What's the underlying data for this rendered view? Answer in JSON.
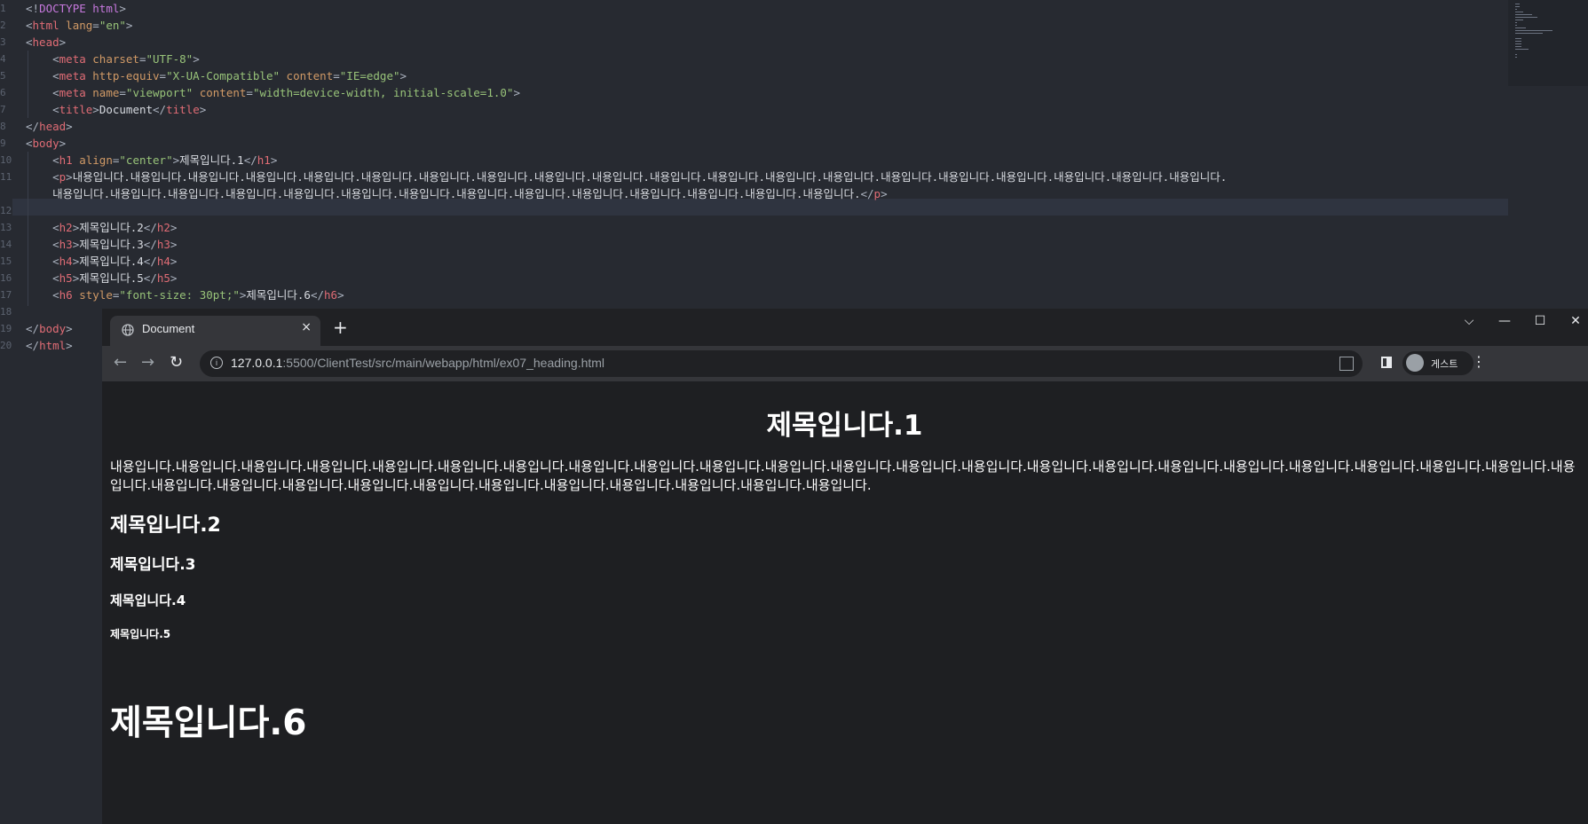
{
  "editor": {
    "lines": [
      {
        "n": "1",
        "parts": [
          [
            "punct",
            "<!"
          ],
          [
            "doct",
            "DOCTYPE"
          ],
          [
            "punct",
            " "
          ],
          [
            "doct",
            "html"
          ],
          [
            "punct",
            ">"
          ]
        ]
      },
      {
        "n": "2",
        "parts": [
          [
            "punct",
            "<"
          ],
          [
            "tag",
            "html"
          ],
          [
            "punct",
            " "
          ],
          [
            "attr",
            "lang"
          ],
          [
            "punct",
            "="
          ],
          [
            "str",
            "\"en\""
          ],
          [
            "punct",
            ">"
          ]
        ]
      },
      {
        "n": "3",
        "parts": [
          [
            "punct",
            "<"
          ],
          [
            "tag",
            "head"
          ],
          [
            "punct",
            ">"
          ]
        ]
      },
      {
        "n": "4",
        "parts": [
          [
            "punct",
            "    <"
          ],
          [
            "tag",
            "meta"
          ],
          [
            "punct",
            " "
          ],
          [
            "attr",
            "charset"
          ],
          [
            "punct",
            "="
          ],
          [
            "str",
            "\"UTF-8\""
          ],
          [
            "punct",
            ">"
          ]
        ]
      },
      {
        "n": "5",
        "parts": [
          [
            "punct",
            "    <"
          ],
          [
            "tag",
            "meta"
          ],
          [
            "punct",
            " "
          ],
          [
            "attr",
            "http-equiv"
          ],
          [
            "punct",
            "="
          ],
          [
            "str",
            "\"X-UA-Compatible\""
          ],
          [
            "punct",
            " "
          ],
          [
            "attr",
            "content"
          ],
          [
            "punct",
            "="
          ],
          [
            "str",
            "\"IE=edge\""
          ],
          [
            "punct",
            ">"
          ]
        ]
      },
      {
        "n": "6",
        "parts": [
          [
            "punct",
            "    <"
          ],
          [
            "tag",
            "meta"
          ],
          [
            "punct",
            " "
          ],
          [
            "attr",
            "name"
          ],
          [
            "punct",
            "="
          ],
          [
            "str",
            "\"viewport\""
          ],
          [
            "punct",
            " "
          ],
          [
            "attr",
            "content"
          ],
          [
            "punct",
            "="
          ],
          [
            "str",
            "\"width=device-width, initial-scale=1.0\""
          ],
          [
            "punct",
            ">"
          ]
        ]
      },
      {
        "n": "7",
        "parts": [
          [
            "punct",
            "    <"
          ],
          [
            "tag",
            "title"
          ],
          [
            "punct",
            ">"
          ],
          [
            "text",
            "Document"
          ],
          [
            "punct",
            "</"
          ],
          [
            "tag",
            "title"
          ],
          [
            "punct",
            ">"
          ]
        ]
      },
      {
        "n": "8",
        "parts": [
          [
            "punct",
            "</"
          ],
          [
            "tag",
            "head"
          ],
          [
            "punct",
            ">"
          ]
        ]
      },
      {
        "n": "9",
        "parts": [
          [
            "punct",
            "<"
          ],
          [
            "tag",
            "body"
          ],
          [
            "punct",
            ">"
          ]
        ]
      },
      {
        "n": "10",
        "parts": [
          [
            "punct",
            "    <"
          ],
          [
            "tag",
            "h1"
          ],
          [
            "punct",
            " "
          ],
          [
            "attr",
            "align"
          ],
          [
            "punct",
            "="
          ],
          [
            "str",
            "\"center\""
          ],
          [
            "punct",
            ">"
          ],
          [
            "text",
            "제목입니다.1"
          ],
          [
            "punct",
            "</"
          ],
          [
            "tag",
            "h1"
          ],
          [
            "punct",
            ">"
          ]
        ]
      },
      {
        "n": "11",
        "parts": [
          [
            "punct",
            "    <"
          ],
          [
            "tag",
            "p"
          ],
          [
            "punct",
            ">"
          ],
          [
            "text",
            "내용입니다.내용입니다.내용입니다.내용입니다.내용입니다.내용입니다.내용입니다.내용입니다.내용입니다.내용입니다.내용입니다.내용입니다.내용입니다.내용입니다.내용입니다.내용입니다.내용입니다.내용입니다.내용입니다.내용입니다."
          ]
        ]
      },
      {
        "n": "",
        "parts": [
          [
            "text",
            "    내용입니다.내용입니다.내용입니다.내용입니다.내용입니다.내용입니다.내용입니다.내용입니다.내용입니다.내용입니다.내용입니다.내용입니다.내용입니다.내용입니다."
          ],
          [
            "punct",
            "</"
          ],
          [
            "tag",
            "p"
          ],
          [
            "punct",
            ">"
          ]
        ]
      },
      {
        "n": "12",
        "parts": []
      },
      {
        "n": "13",
        "parts": [
          [
            "punct",
            "    <"
          ],
          [
            "tag",
            "h2"
          ],
          [
            "punct",
            ">"
          ],
          [
            "text",
            "제목입니다.2"
          ],
          [
            "punct",
            "</"
          ],
          [
            "tag",
            "h2"
          ],
          [
            "punct",
            ">"
          ]
        ]
      },
      {
        "n": "14",
        "parts": [
          [
            "punct",
            "    <"
          ],
          [
            "tag",
            "h3"
          ],
          [
            "punct",
            ">"
          ],
          [
            "text",
            "제목입니다.3"
          ],
          [
            "punct",
            "</"
          ],
          [
            "tag",
            "h3"
          ],
          [
            "punct",
            ">"
          ]
        ]
      },
      {
        "n": "15",
        "parts": [
          [
            "punct",
            "    <"
          ],
          [
            "tag",
            "h4"
          ],
          [
            "punct",
            ">"
          ],
          [
            "text",
            "제목입니다.4"
          ],
          [
            "punct",
            "</"
          ],
          [
            "tag",
            "h4"
          ],
          [
            "punct",
            ">"
          ]
        ]
      },
      {
        "n": "16",
        "parts": [
          [
            "punct",
            "    <"
          ],
          [
            "tag",
            "h5"
          ],
          [
            "punct",
            ">"
          ],
          [
            "text",
            "제목입니다.5"
          ],
          [
            "punct",
            "</"
          ],
          [
            "tag",
            "h5"
          ],
          [
            "punct",
            ">"
          ]
        ]
      },
      {
        "n": "17",
        "parts": [
          [
            "punct",
            "    <"
          ],
          [
            "tag",
            "h6"
          ],
          [
            "punct",
            " "
          ],
          [
            "attr",
            "style"
          ],
          [
            "punct",
            "="
          ],
          [
            "str",
            "\"font-size: 30pt;\""
          ],
          [
            "punct",
            ">"
          ],
          [
            "text",
            "제목입니다.6"
          ],
          [
            "punct",
            "</"
          ],
          [
            "tag",
            "h6"
          ],
          [
            "punct",
            ">"
          ]
        ]
      },
      {
        "n": "18",
        "parts": []
      },
      {
        "n": "19",
        "parts": [
          [
            "punct",
            "</"
          ],
          [
            "tag",
            "body"
          ],
          [
            "punct",
            ">"
          ]
        ]
      },
      {
        "n": "20",
        "parts": [
          [
            "punct",
            "</"
          ],
          [
            "tag",
            "html"
          ],
          [
            "punct",
            ">"
          ]
        ]
      }
    ]
  },
  "browser": {
    "tab_title": "Document",
    "tab_close": "×",
    "new_tab": "+",
    "url_host": "127.0.0.1",
    "url_rest": ":5500/ClientTest/src/main/webapp/html/ex07_heading.html",
    "profile_name": "게스트",
    "controls": {
      "dropdown": "⌵",
      "minimize": "—",
      "maximize": "☐",
      "close": "✕"
    },
    "nav": {
      "back": "←",
      "forward": "→",
      "reload": "↻"
    },
    "menu": "⋮"
  },
  "page": {
    "h1": "제목입니다.1",
    "p": "내용입니다.내용입니다.내용입니다.내용입니다.내용입니다.내용입니다.내용입니다.내용입니다.내용입니다.내용입니다.내용입니다.내용입니다.내용입니다.내용입니다.내용입니다.내용입니다.내용입니다.내용입니다.내용입니다.내용입니다.내용입니다.내용입니다.내용입니다.내용입니다.내용입니다.내용입니다.내용입니다.내용입니다.내용입니다.내용입니다.내용입니다.내용입니다.내용입니다.내용입니다.",
    "h2": "제목입니다.2",
    "h3": "제목입니다.3",
    "h4": "제목입니다.4",
    "h5": "제목입니다.5",
    "h6": "제목입니다.6"
  }
}
